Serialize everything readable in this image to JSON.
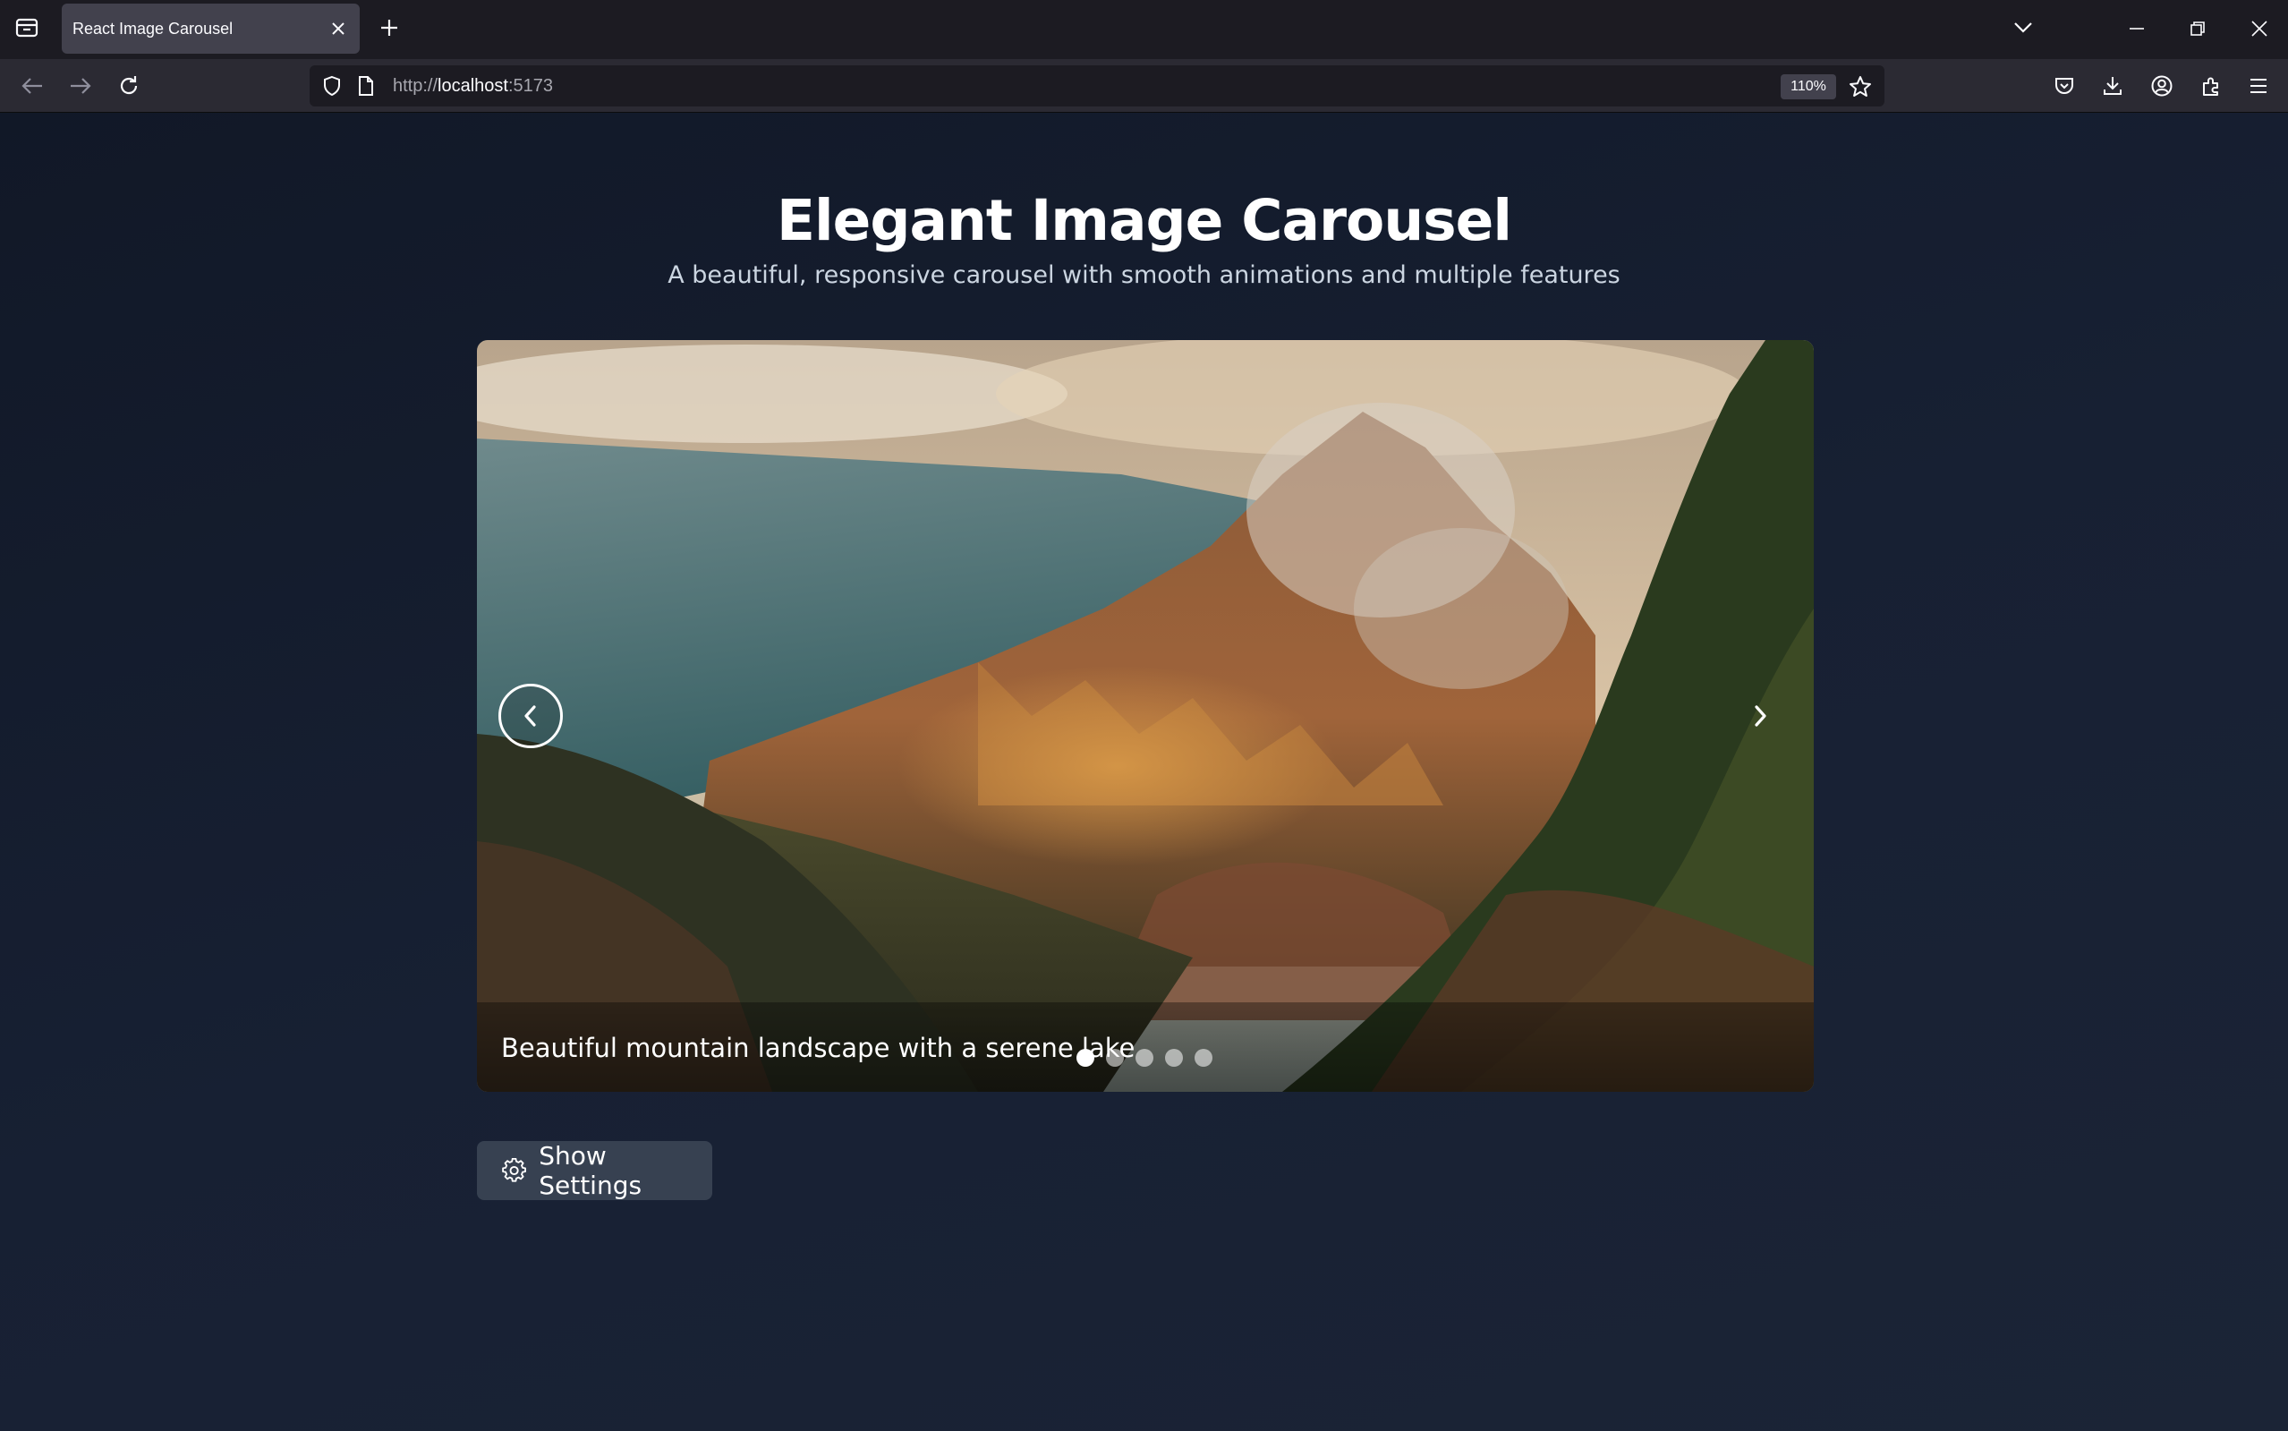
{
  "browser": {
    "tab_title": "React Image Carousel",
    "url_scheme": "http://",
    "url_host": "localhost",
    "url_port": ":5173",
    "zoom": "110%"
  },
  "page": {
    "title": "Elegant Image Carousel",
    "subtitle": "A beautiful, responsive carousel with smooth animations and multiple features"
  },
  "carousel": {
    "caption": "Beautiful mountain landscape with a serene lake",
    "slide_count": 5,
    "active_index": 0
  },
  "settings_button": {
    "label": "Show Settings"
  }
}
